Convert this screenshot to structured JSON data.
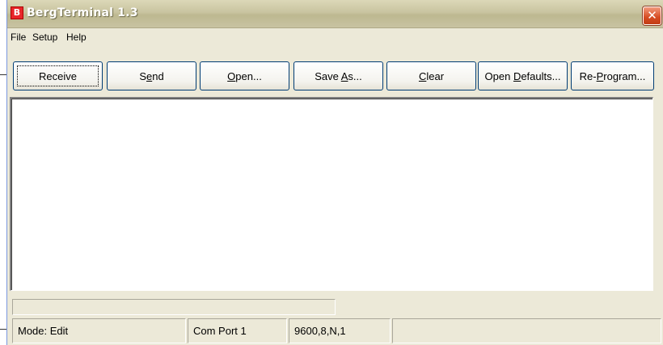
{
  "window": {
    "title": "BergTerminal 1.3",
    "app_icon_letter": "B",
    "close_glyph": "✕"
  },
  "menu": [
    "File",
    "Setup",
    "Help"
  ],
  "toolbar": {
    "receive": "Receive",
    "send_pre": "S",
    "send_mn": "e",
    "send_post": "nd",
    "open_mn": "O",
    "open_post": "pen...",
    "saveas_pre": "Save ",
    "saveas_mn": "A",
    "saveas_post": "s...",
    "clear_mn": "C",
    "clear_post": "lear",
    "opendef_pre": "Open ",
    "opendef_mn": "D",
    "opendef_post": "efaults...",
    "reprog_pre": "Re-",
    "reprog_mn": "P",
    "reprog_post": "rogram..."
  },
  "terminal": {
    "content": ""
  },
  "progress": {
    "value": 0
  },
  "status": {
    "mode": "Mode: Edit",
    "port": "Com Port 1",
    "settings": "9600,8,N,1",
    "extra": ""
  },
  "colors": {
    "window_bg": "#ece9d8",
    "close_red": "#d64b22",
    "button_border": "#003c74"
  },
  "icons": {
    "app": "app-logo-icon",
    "close": "close-icon"
  }
}
